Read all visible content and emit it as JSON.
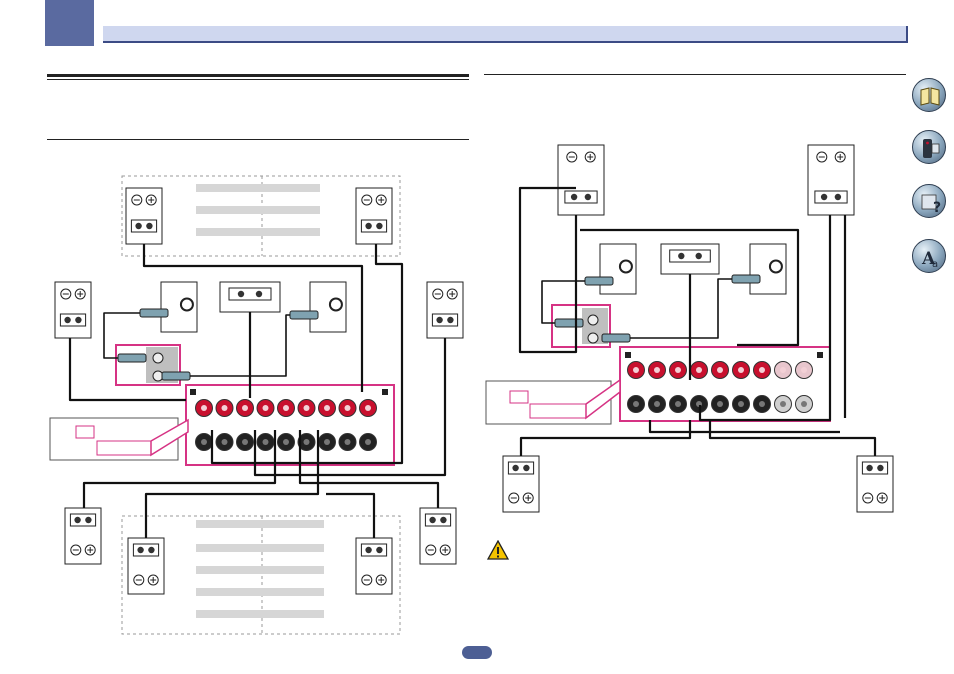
{
  "page": {
    "accent_color": "#5a6aa0",
    "header_bar_color": "#cfd7ef",
    "terminal_red": "#c8102e",
    "cable_pink": "#d63384",
    "page_number": ""
  },
  "nav_icons": [
    {
      "name": "manual-book-icon"
    },
    {
      "name": "remote-control-icon"
    },
    {
      "name": "faq-help-icon"
    },
    {
      "name": "language-glossary-icon"
    }
  ],
  "diagram_left": {
    "speaker_count": 8,
    "subwoofer_count": 2,
    "terminal_pairs": 9
  },
  "diagram_right": {
    "speaker_count": 5,
    "subwoofer_count": 2,
    "terminal_pairs": 8
  },
  "caution": {
    "icon": "caution-triangle-icon"
  }
}
